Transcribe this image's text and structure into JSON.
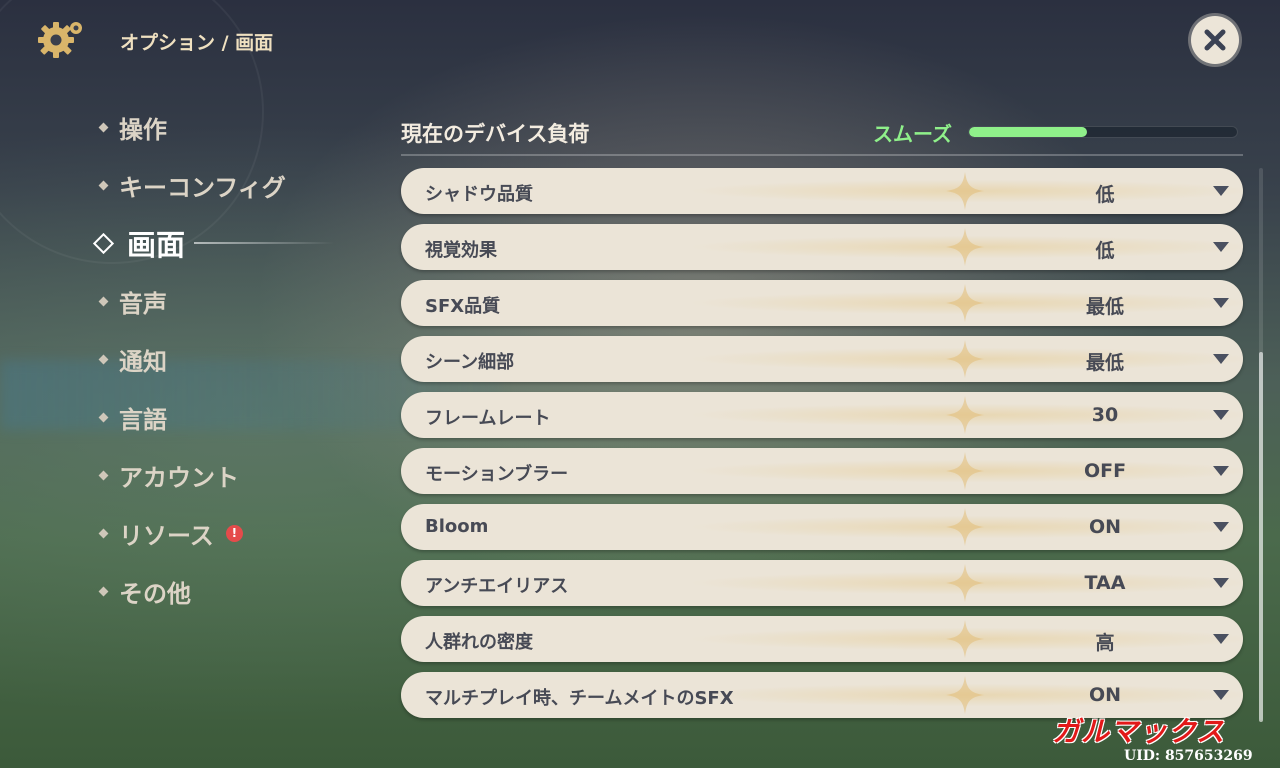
{
  "header": {
    "breadcrumb": "オプション / 画面",
    "settings_icon": "gear-icon",
    "close_icon": "close-icon"
  },
  "sidebar": {
    "items": [
      {
        "label": "操作",
        "active": false
      },
      {
        "label": "キーコンフィグ",
        "active": false
      },
      {
        "label": "画面",
        "active": true
      },
      {
        "label": "音声",
        "active": false
      },
      {
        "label": "通知",
        "active": false
      },
      {
        "label": "言語",
        "active": false
      },
      {
        "label": "アカウント",
        "active": false
      },
      {
        "label": "リソース",
        "active": false,
        "badge": "!"
      },
      {
        "label": "その他",
        "active": false
      }
    ]
  },
  "device_load": {
    "title": "現在のデバイス負荷",
    "status": "スムーズ",
    "level": 0.44,
    "color": "#8ff08a"
  },
  "settings": [
    {
      "label": "シャドウ品質",
      "value": "低"
    },
    {
      "label": "視覚効果",
      "value": "低"
    },
    {
      "label": "SFX品質",
      "value": "最低"
    },
    {
      "label": "シーン細部",
      "value": "最低"
    },
    {
      "label": "フレームレート",
      "value": "30"
    },
    {
      "label": "モーションブラー",
      "value": "OFF"
    },
    {
      "label": "Bloom",
      "value": "ON"
    },
    {
      "label": "アンチエイリアス",
      "value": "TAA"
    },
    {
      "label": "人群れの密度",
      "value": "高"
    },
    {
      "label": "マルチプレイ時、チームメイトのSFX",
      "value": "ON"
    }
  ],
  "watermark": "ガルマックス",
  "uid": "UID: 857653269"
}
